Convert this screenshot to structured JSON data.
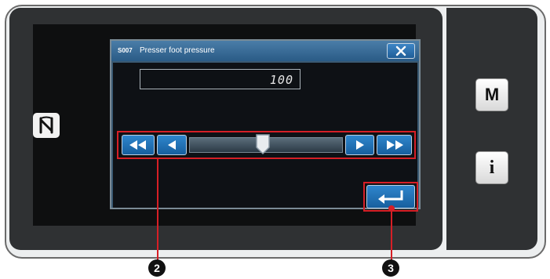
{
  "dialog": {
    "code": "S007",
    "title": "Presser foot pressure",
    "value": "100"
  },
  "slider": {
    "level": 0.48,
    "buttons": [
      "fast-left",
      "left",
      "right",
      "fast-right"
    ]
  },
  "side": {
    "mode_label": "M",
    "info_label": "i"
  },
  "callouts": {
    "slider_callout": "2",
    "enter_callout": "3"
  },
  "colors": {
    "accent_red": "#d61f26",
    "button_blue": "#1f6fb3",
    "title_bar": "#3b6e9b"
  }
}
